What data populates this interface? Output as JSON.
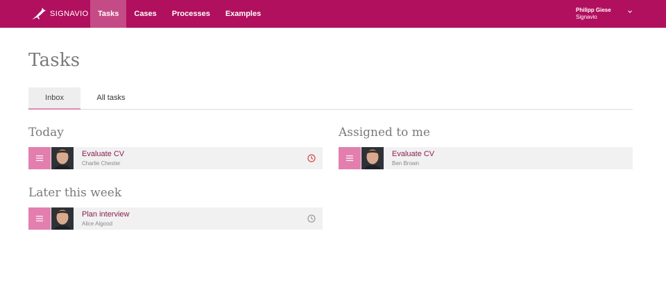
{
  "header": {
    "brand": "SIGNAVIO",
    "nav": [
      "Tasks",
      "Cases",
      "Processes",
      "Examples"
    ],
    "active_nav": "Tasks",
    "user": {
      "name": "Philipp Giese",
      "org": "Signavio"
    }
  },
  "page": {
    "title": "Tasks",
    "tabs": [
      "Inbox",
      "All tasks"
    ],
    "active_tab": "Inbox"
  },
  "sections": {
    "today": {
      "title": "Today",
      "tasks": [
        {
          "title": "Evaluate CV",
          "assignee": "Charlie Chester",
          "clock_color": "#d64545"
        }
      ]
    },
    "later": {
      "title": "Later this week",
      "tasks": [
        {
          "title": "Plan interview",
          "assignee": "Alice Algood",
          "clock_color": "#9a9a9a"
        }
      ]
    },
    "assigned": {
      "title": "Assigned to me",
      "tasks": [
        {
          "title": "Evaluate CV",
          "assignee": "Ben Brown"
        }
      ]
    }
  },
  "colors": {
    "brand": "#b1105e",
    "nav_active": "#c54b86",
    "menu_button": "#e37fae",
    "task_title": "#8b1d4f"
  },
  "icons": [
    "signavio-logo-icon",
    "chevron-down-icon",
    "menu-icon",
    "avatar-photo",
    "clock-icon"
  ]
}
